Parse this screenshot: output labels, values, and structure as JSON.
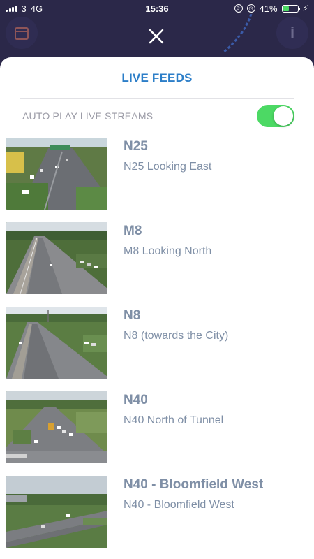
{
  "status_bar": {
    "carrier": "3",
    "network": "4G",
    "time": "15:36",
    "battery": "41%",
    "battery_level": 0.41
  },
  "background": {
    "info_icon_label": "i",
    "calendar_icon": "calendar-icon",
    "close_icon": "close-icon"
  },
  "sheet": {
    "title": "LIVE FEEDS",
    "autoplay_label": "AUTO PLAY LIVE STREAMS",
    "autoplay_on": true
  },
  "feeds": [
    {
      "name": "N25",
      "description": "N25 Looking East"
    },
    {
      "name": "M8",
      "description": "M8 Looking North"
    },
    {
      "name": "N8",
      "description": "N8 (towards the City)"
    },
    {
      "name": "N40",
      "description": "N40 North of Tunnel"
    },
    {
      "name": "N40 - Bloomfield West",
      "description": "N40 - Bloomfield West"
    }
  ],
  "colors": {
    "accent": "#2c7ec8",
    "toggle_on": "#4cd964",
    "feed_text": "#7f8fa6",
    "background": "#2b2849"
  }
}
